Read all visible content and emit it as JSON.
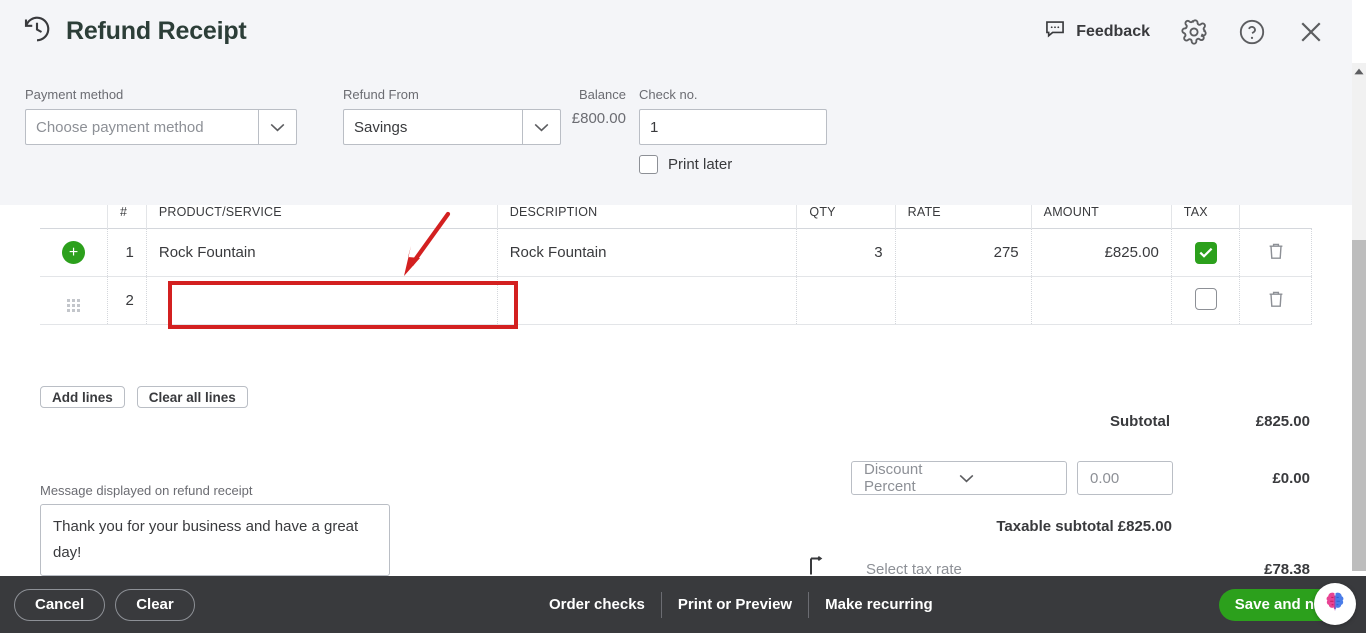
{
  "header": {
    "title": "Refund Receipt",
    "history_icon": "history-clock-icon",
    "feedback_label": "Feedback",
    "settings_icon": "gear-icon",
    "help_icon": "help-circle-icon",
    "close_icon": "close-icon"
  },
  "form": {
    "payment_method": {
      "label": "Payment method",
      "placeholder": "Choose payment method",
      "value": ""
    },
    "refund_from": {
      "label": "Refund From",
      "value": "Savings"
    },
    "balance": {
      "label": "Balance",
      "value": "£800.00"
    },
    "check_no": {
      "label": "Check no.",
      "value": "1"
    },
    "print_later": {
      "label": "Print later",
      "checked": false
    }
  },
  "table": {
    "columns": [
      "",
      "#",
      "PRODUCT/SERVICE",
      "DESCRIPTION",
      "QTY",
      "RATE",
      "AMOUNT",
      "TAX",
      ""
    ],
    "rows": [
      {
        "num": "1",
        "product_service": "Rock Fountain",
        "description": "Rock Fountain",
        "qty": "3",
        "rate": "275",
        "amount": "£825.00",
        "tax": true
      },
      {
        "num": "2",
        "product_service": "",
        "description": "",
        "qty": "",
        "rate": "",
        "amount": "",
        "tax": false
      }
    ],
    "add_lines_label": "Add lines",
    "clear_all_lines_label": "Clear all lines"
  },
  "totals": {
    "subtotal_label": "Subtotal",
    "subtotal_value": "£825.00",
    "discount_type": "Discount Percent",
    "discount_amount": "0.00",
    "discount_value": "£0.00",
    "taxable_subtotal": "Taxable subtotal £825.00",
    "tax_rate_placeholder": "Select tax rate",
    "tax_value": "£78.38"
  },
  "message": {
    "label": "Message displayed on refund receipt",
    "value": "Thank you for your business and have a great day!"
  },
  "footer": {
    "cancel_label": "Cancel",
    "clear_label": "Clear",
    "order_checks_label": "Order checks",
    "print_preview_label": "Print or Preview",
    "make_recurring_label": "Make recurring",
    "save_and_new_label": "Save and new",
    "assistant_icon": "ai-brain-icon"
  },
  "colors": {
    "brand_green": "#2ca01c",
    "footer_dark": "#393a3d",
    "header_bg": "#f4f5f8",
    "annotation_red": "#d32020"
  }
}
